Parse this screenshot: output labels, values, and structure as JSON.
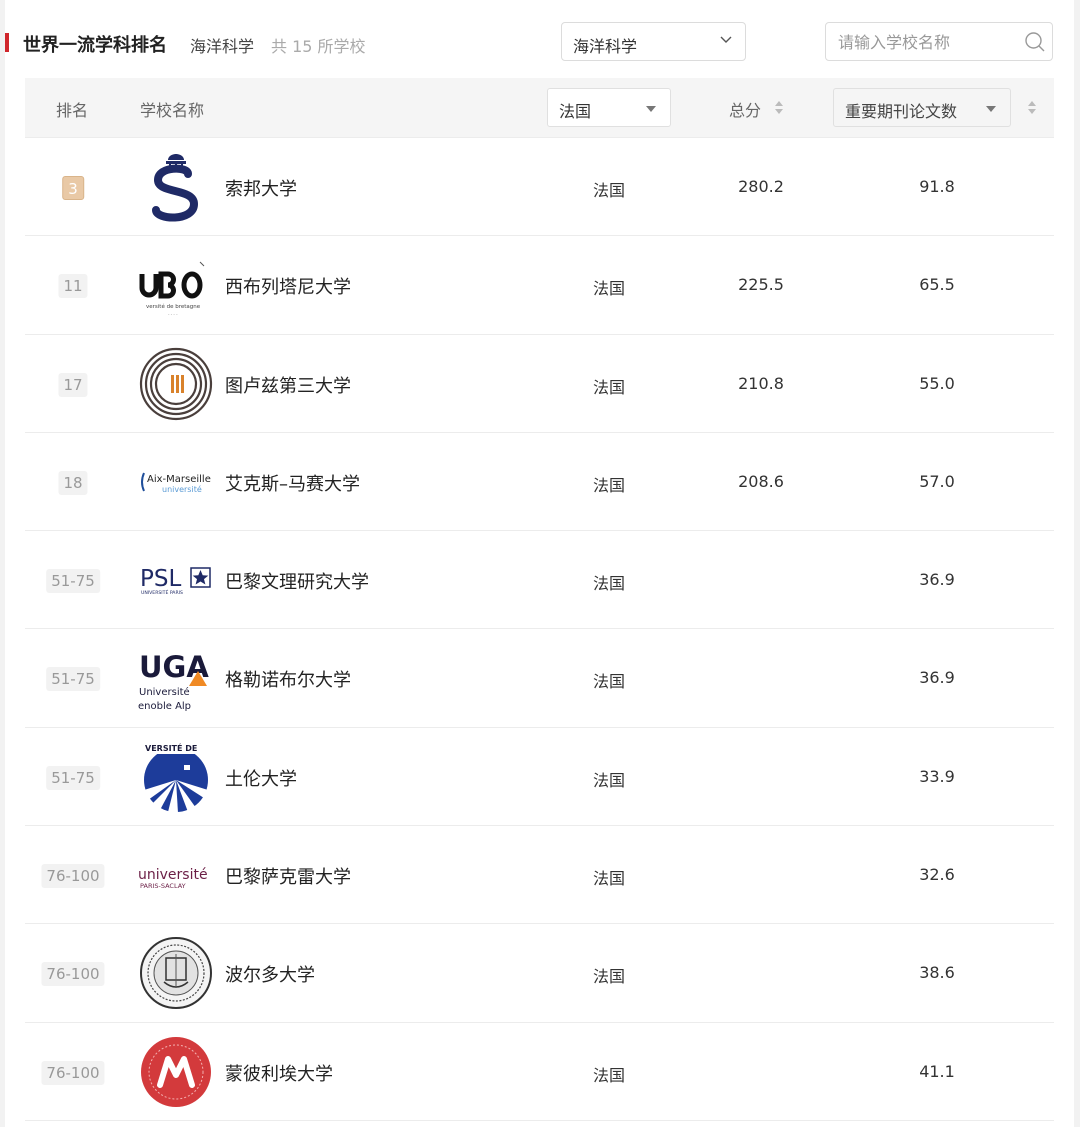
{
  "header": {
    "title": "世界一流学科排名",
    "subject": "海洋科学",
    "count": "共 15 所学校"
  },
  "subject_select": {
    "value": "海洋科学"
  },
  "search": {
    "placeholder": "请输入学校名称"
  },
  "table": {
    "col_rank": "排名",
    "col_name": "学校名称",
    "country_filter": "法国",
    "col_score": "总分",
    "indicator_filter": "重要期刊论文数"
  },
  "logo_text": {
    "ubo_sub": "versité de bretagne",
    "aix_main": "Aix-Marseille",
    "aix_sub": "université",
    "psl_main": "PSL",
    "psl_sub": "UNIVERSITÉ PARIS",
    "uga_main": "UGA",
    "uga_sub1": "Université",
    "uga_sub2": "enoble Alp",
    "toulon_arc": "VERSITÉ DE",
    "saclay_main": "université",
    "saclay_sub": "PARIS-SACLAY"
  },
  "colors": {
    "accent": "#d0262c",
    "top_rank_badge": "#e9c9a6",
    "sorbonne_navy": "#1f2a66",
    "saclay_plum": "#6b1f46",
    "montpellier_red": "#d33a3c"
  },
  "rows": [
    {
      "rank": "3",
      "name": "索邦大学",
      "country": "法国",
      "score": "280.2",
      "papers": "91.8",
      "logo": "sorbonne-logo",
      "top": true
    },
    {
      "rank": "11",
      "name": "西布列塔尼大学",
      "country": "法国",
      "score": "225.5",
      "papers": "65.5",
      "logo": "ubo-logo"
    },
    {
      "rank": "17",
      "name": "图卢兹第三大学",
      "country": "法国",
      "score": "210.8",
      "papers": "55.0",
      "logo": "toulouse-logo"
    },
    {
      "rank": "18",
      "name": "艾克斯–马赛大学",
      "country": "法国",
      "score": "208.6",
      "papers": "57.0",
      "logo": "amu-logo"
    },
    {
      "rank": "51-75",
      "name": "巴黎文理研究大学",
      "country": "法国",
      "score": "",
      "papers": "36.9",
      "logo": "psl-logo"
    },
    {
      "rank": "51-75",
      "name": "格勒诺布尔大学",
      "country": "法国",
      "score": "",
      "papers": "36.9",
      "logo": "uga-logo"
    },
    {
      "rank": "51-75",
      "name": "土伦大学",
      "country": "法国",
      "score": "",
      "papers": "33.9",
      "logo": "toulon-logo"
    },
    {
      "rank": "76-100",
      "name": "巴黎萨克雷大学",
      "country": "法国",
      "score": "",
      "papers": "32.6",
      "logo": "saclay-logo"
    },
    {
      "rank": "76-100",
      "name": "波尔多大学",
      "country": "法国",
      "score": "",
      "papers": "38.6",
      "logo": "bordeaux-logo"
    },
    {
      "rank": "76-100",
      "name": "蒙彼利埃大学",
      "country": "法国",
      "score": "",
      "papers": "41.1",
      "logo": "montpellier-logo"
    }
  ]
}
